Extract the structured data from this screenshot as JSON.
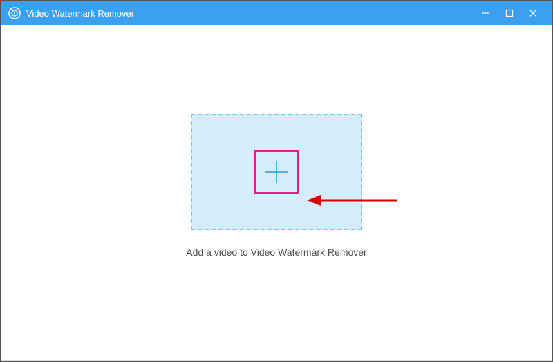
{
  "titlebar": {
    "app_title": "Video Watermark Remover"
  },
  "main": {
    "instruction": "Add a video to Video Watermark Remover"
  },
  "colors": {
    "accent": "#3aa0ef",
    "dropzone_bg": "#d5ecfb",
    "dropzone_border": "#7fc3ed",
    "highlight": "#e41d8e",
    "arrow": "#d90000"
  }
}
